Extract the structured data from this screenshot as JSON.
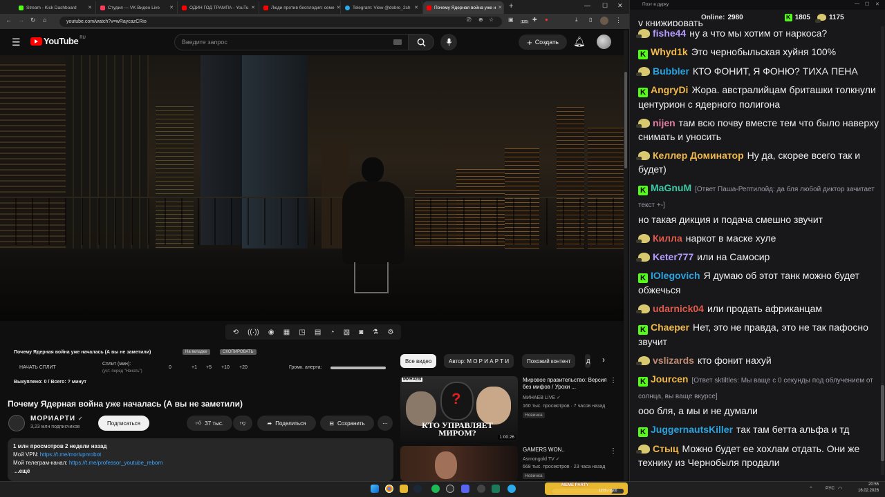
{
  "browser": {
    "tabs": [
      {
        "label": "Stream - Kick Dashboard",
        "color": "#53fc18"
      },
      {
        "label": "Студия — VK Видео Live",
        "color": "#ff3b5c"
      },
      {
        "label": "ОДИН ГОД ТРАМПА - YouTu",
        "color": "#ff0000"
      },
      {
        "label": "Люди против бесплодия: семе",
        "color": "#ff0000"
      },
      {
        "label": "Telegram: View @dobro_2ch",
        "color": "#2aabee"
      },
      {
        "label": "Почему Ядерная война уже н",
        "color": "#ff0000",
        "active": true
      }
    ],
    "url": "youtube.com/watch?v=wRaycazCRio",
    "ext_badge_1": "125"
  },
  "youtube": {
    "logo_text": "YouTube",
    "logo_region": "RU",
    "search_placeholder": "Введите запрос",
    "create_label": "Создать"
  },
  "extension": {
    "title": "Почему Ядерная война уже началась (А вы не заметили)",
    "tag1": "На вкладке",
    "tag2": "СКОПИРОВАТЬ",
    "start_split": "НАЧАТЬ СПЛИТ",
    "split_label": "Сплит (мин):",
    "split_hint": "(уст. перед \"Начать\")",
    "split_value": "0",
    "btn_plus1": "+1",
    "btn_plus5": "+5",
    "btn_plus10": "+10",
    "btn_plus20": "+20",
    "alert_volume": "Громк. алерта:",
    "bought": "Выкуплено: 0 / Всего: ? минут"
  },
  "video": {
    "title": "Почему Ядерная война уже началась (А вы не заметили)",
    "channel": "МОРИАРТИ",
    "subscribers": "3,23 млн подписчиков",
    "subscribe": "Подписаться",
    "likes": "37 тыс.",
    "share": "Поделиться",
    "save": "Сохранить",
    "desc_stats": "1 млн просмотров  2 недели назад",
    "desc_vpn_label": "Мой VPN: ",
    "desc_vpn_link": "https://t.me/morivpnrobot",
    "desc_tg_label": "Мой телеграм-канал: ",
    "desc_tg_link": "https://t.me/professor_youtube_reborn",
    "desc_more": "...ещё"
  },
  "recommendations": {
    "chips": [
      "Все видео",
      "Автор: М О Р И А Р Т И",
      "Похожий контент",
      "Д"
    ],
    "items": [
      {
        "title": "Мировое правительство: Версия без мифов / Уроки ...",
        "channel": "МИНАЕВ LIVE",
        "meta": "160 тыс. просмотров · 7 часов назад",
        "badge": "Новинка",
        "duration": "1:00:26",
        "thumb_caption": "КТО УПРАВЛЯЕТ МИРОМ?",
        "thumb_brand": "МИНАЕВ"
      },
      {
        "title": "GAMERS WON..",
        "channel": "Asmongold TV",
        "meta": "668 тыс. просмотров · 23 часа назад",
        "badge": "Новинка"
      }
    ]
  },
  "chat": {
    "window_title": "Поэт в дурку",
    "online_label": "Online:",
    "online_count": "2980",
    "kick_count": "1805",
    "other_count": "1175",
    "top_fragment": "у книжировать",
    "messages": [
      {
        "platform": "vk",
        "name": "fishe44",
        "color": "#b59bff",
        "text": "ну а что мы хотим от наркоса?"
      },
      {
        "platform": "kick",
        "name": "Whyd1k",
        "color": "#f0b84a",
        "text": "Это чернобыльская хуйня 100%"
      },
      {
        "platform": "vk",
        "name": "Bubbler",
        "color": "#29a3e0",
        "text": "КТО ФОНИТ, Я ФОНЮ? ТИХА ПЕНА"
      },
      {
        "platform": "kick",
        "name": "AngryDi",
        "color": "#f0b84a",
        "text": "Жора. австралийцам бриташки толкнули центурион с ядерного полигона"
      },
      {
        "platform": "vk",
        "name": "nijen",
        "color": "#e07fa0",
        "text": "там всю почву вместе тем что было наверху снимать и уносить"
      },
      {
        "platform": "vk",
        "name": "Келлер Доминатор",
        "color": "#f0b84a",
        "text": "Ну да, скорее всего так и будет)"
      },
      {
        "platform": "kick",
        "name": "MaGnuM",
        "color": "#3ec9a7",
        "reply": "[Ответ Паша-Рептилойд: да бля любой диктор зачитает текст +-]",
        "text": "но такая дикция и подача смешно звучит"
      },
      {
        "platform": "vk",
        "name": "Килла",
        "color": "#e05a4a",
        "text": "наркот в маске хуле"
      },
      {
        "platform": "vk",
        "name": "Keter777",
        "color": "#b59bff",
        "text": "или на Самосир"
      },
      {
        "platform": "kick",
        "name": "IOlegovich",
        "color": "#29a3e0",
        "text": "Я думаю об этот танк можно будет обжечься"
      },
      {
        "platform": "vk",
        "name": "udarnick04",
        "color": "#e05a4a",
        "text": "или продать африканцам"
      },
      {
        "platform": "kick",
        "name": "Chaeper",
        "color": "#f0b84a",
        "text": "Нет, это не правда, это не так пафосно звучит"
      },
      {
        "platform": "vk",
        "name": "vslizards",
        "color": "#c08b70",
        "text": "кто фонит нахуй"
      },
      {
        "platform": "kick",
        "name": "Jourcen",
        "color": "#f0b84a",
        "reply": "[Ответ sktiltles: Мы ваще с 0 секунды под облучением от солнца, вы ваще вкурсе]",
        "text": "ооо бля, а мы и не думали"
      },
      {
        "platform": "kick",
        "name": "JuggernautsKiller",
        "color": "#29a3e0",
        "text": "так там бетта альфа и тд"
      },
      {
        "platform": "vk",
        "name": "Стыц",
        "color": "#f0b84a",
        "text": "Можно будет ее хохлам отдать. Они же технику из Чернобыля продали"
      }
    ]
  },
  "taskbar": {
    "meme_label": "MEME PARTY",
    "meme_count": "1275 / 1500",
    "lang": "РУС",
    "time": "20:55",
    "date": "16.02.2026"
  }
}
